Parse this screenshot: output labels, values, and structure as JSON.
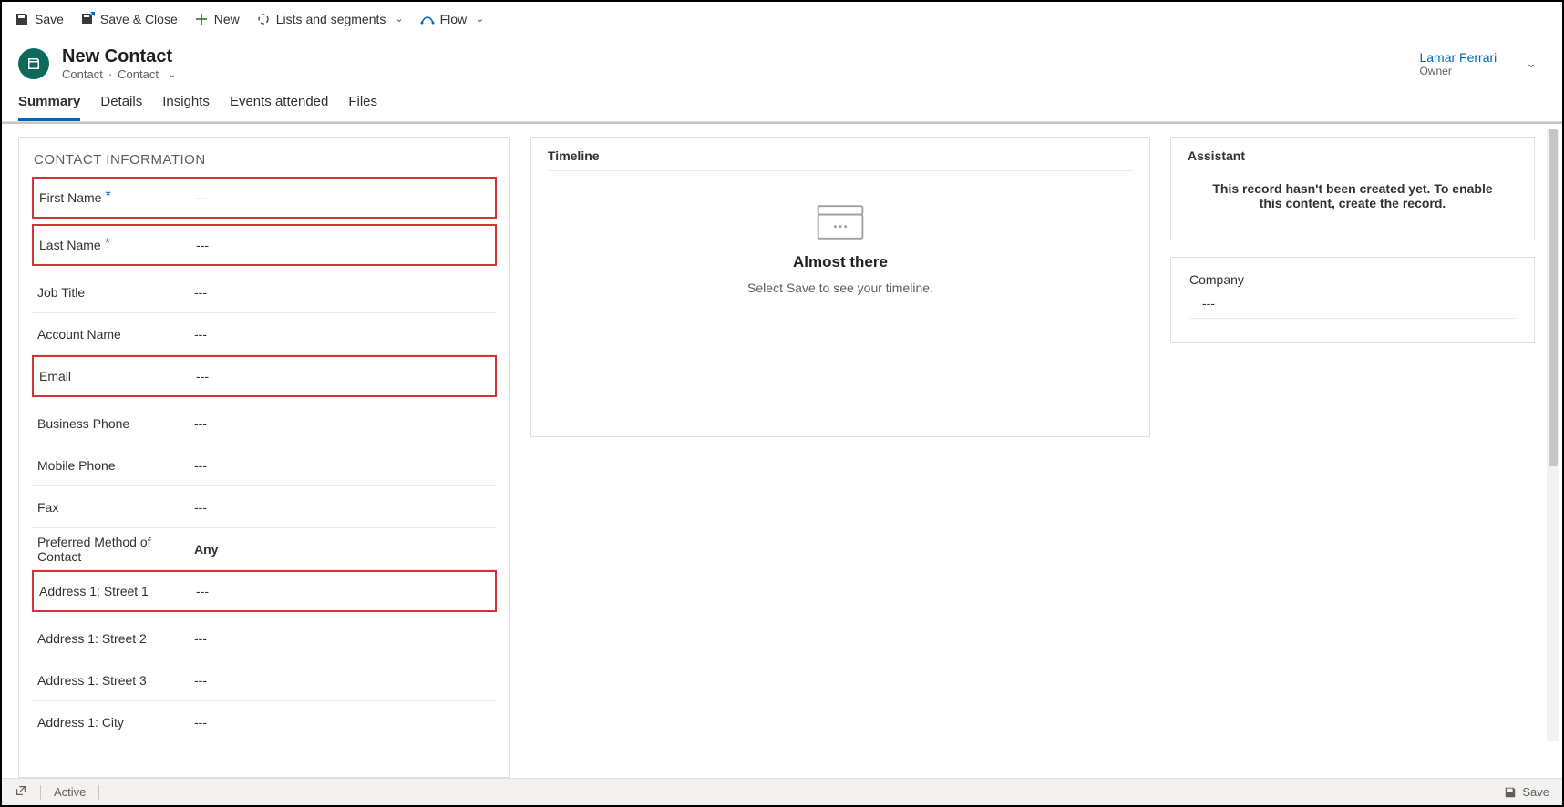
{
  "commands": {
    "save": "Save",
    "save_close": "Save & Close",
    "new": "New",
    "lists": "Lists and segments",
    "flow": "Flow"
  },
  "header": {
    "title": "New Contact",
    "breadcrumb1": "Contact",
    "breadcrumb2": "Contact",
    "owner_name": "Lamar Ferrari",
    "owner_label": "Owner"
  },
  "tabs": {
    "summary": "Summary",
    "details": "Details",
    "insights": "Insights",
    "events": "Events attended",
    "files": "Files"
  },
  "contact_section": {
    "title": "CONTACT INFORMATION",
    "fields": {
      "first_name": {
        "label": "First Name",
        "value": "---"
      },
      "last_name": {
        "label": "Last Name",
        "value": "---"
      },
      "job_title": {
        "label": "Job Title",
        "value": "---"
      },
      "account_name": {
        "label": "Account Name",
        "value": "---"
      },
      "email": {
        "label": "Email",
        "value": "---"
      },
      "business_phone": {
        "label": "Business Phone",
        "value": "---"
      },
      "mobile_phone": {
        "label": "Mobile Phone",
        "value": "---"
      },
      "fax": {
        "label": "Fax",
        "value": "---"
      },
      "pref_method": {
        "label": "Preferred Method of Contact",
        "value": "Any"
      },
      "addr1_s1": {
        "label": "Address 1: Street 1",
        "value": "---"
      },
      "addr1_s2": {
        "label": "Address 1: Street 2",
        "value": "---"
      },
      "addr1_s3": {
        "label": "Address 1: Street 3",
        "value": "---"
      },
      "addr1_city": {
        "label": "Address 1: City",
        "value": "---"
      }
    }
  },
  "timeline": {
    "title": "Timeline",
    "heading": "Almost there",
    "subtext": "Select Save to see your timeline."
  },
  "assistant": {
    "title": "Assistant",
    "message": "This record hasn't been created yet. To enable this content, create the record."
  },
  "company": {
    "label": "Company",
    "value": "---"
  },
  "statusbar": {
    "status": "Active",
    "save": "Save"
  }
}
